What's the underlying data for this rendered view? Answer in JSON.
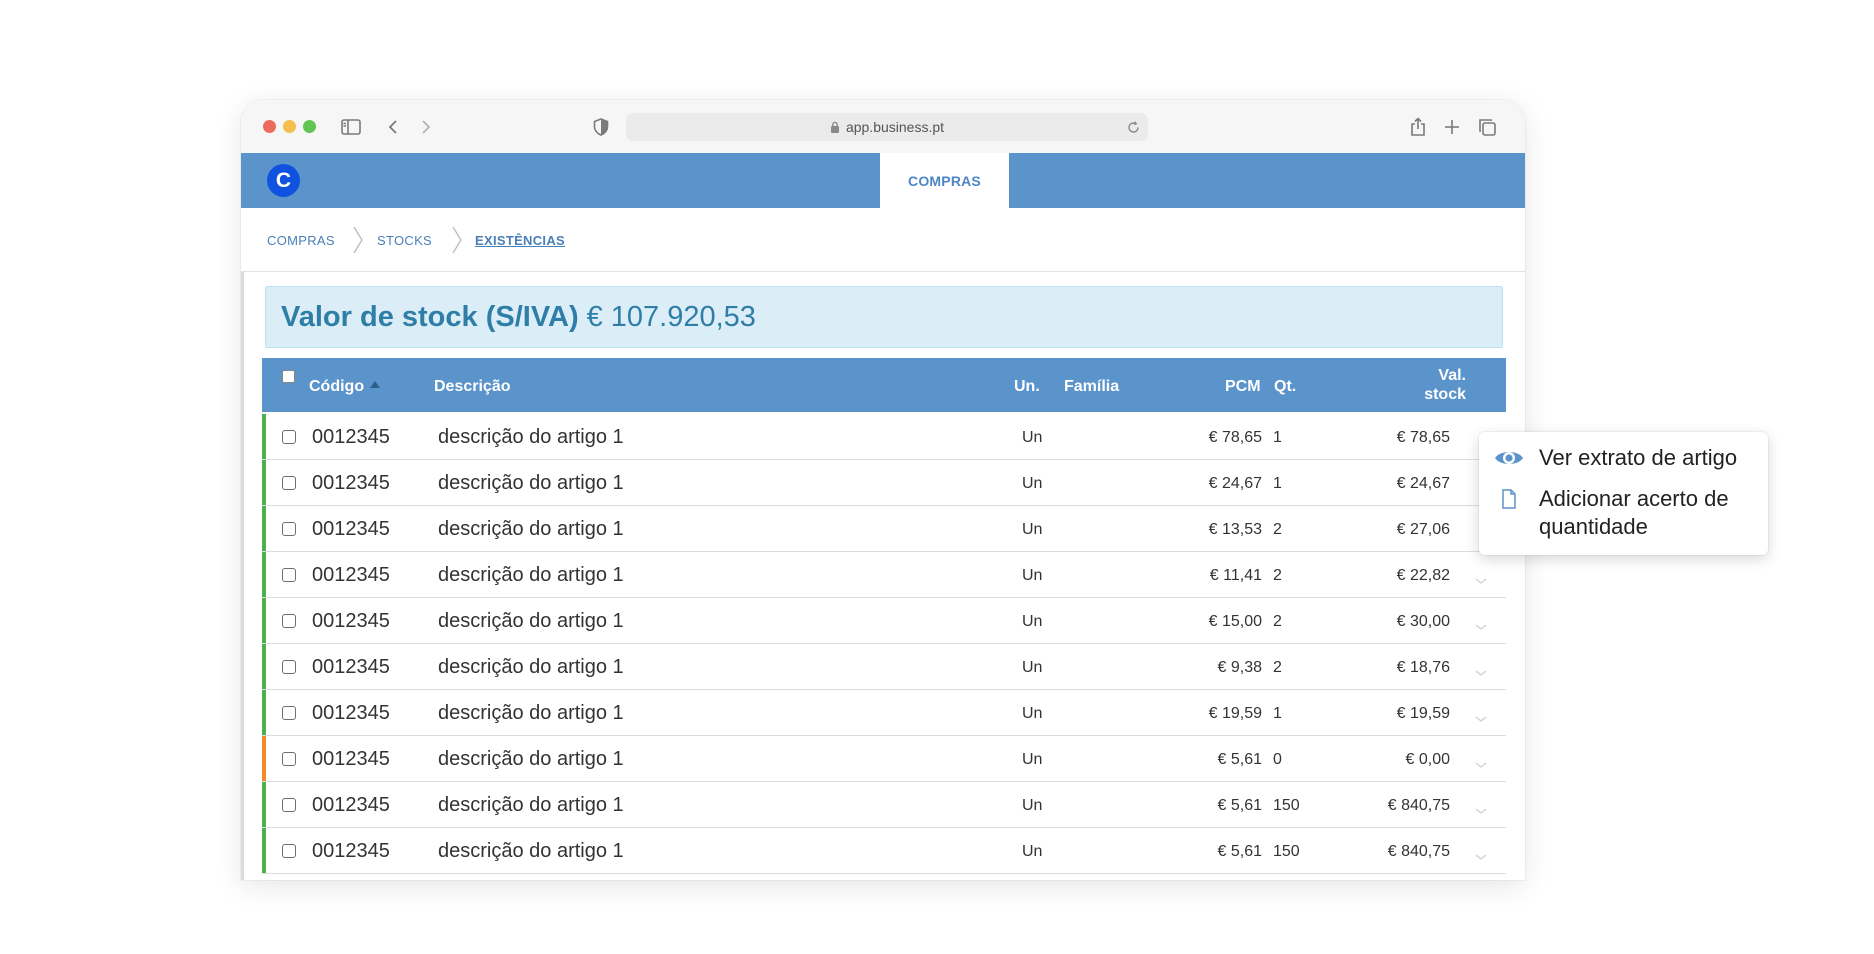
{
  "browser": {
    "url": "app.business.pt"
  },
  "app": {
    "logo_letter": "C",
    "active_tab": "COMPRAS"
  },
  "breadcrumb": {
    "items": [
      "COMPRAS",
      "STOCKS",
      "EXISTÊNCIAS"
    ]
  },
  "summary": {
    "label": "Valor de stock (S/IVA)",
    "value": "€ 107.920,53"
  },
  "table": {
    "headers": {
      "codigo": "Código",
      "descricao": "Descrição",
      "un": "Un.",
      "familia": "Família",
      "pcm": "PCM",
      "qt": "Qt.",
      "val_stock_1": "Val.",
      "val_stock_2": "stock"
    },
    "rows": [
      {
        "status_color": "#4caf50",
        "code": "0012345",
        "desc": "descrição do artigo 1",
        "un": "Un",
        "pcm": "€ 78,65",
        "qt": "1",
        "val": "€ 78,65"
      },
      {
        "status_color": "#4caf50",
        "code": "0012345",
        "desc": "descrição do artigo 1",
        "un": "Un",
        "pcm": "€ 24,67",
        "qt": "1",
        "val": "€ 24,67"
      },
      {
        "status_color": "#4caf50",
        "code": "0012345",
        "desc": "descrição do artigo 1",
        "un": "Un",
        "pcm": "€ 13,53",
        "qt": "2",
        "val": "€ 27,06"
      },
      {
        "status_color": "#4caf50",
        "code": "0012345",
        "desc": "descrição do artigo 1",
        "un": "Un",
        "pcm": "€ 11,41",
        "qt": "2",
        "val": "€ 22,82"
      },
      {
        "status_color": "#4caf50",
        "code": "0012345",
        "desc": "descrição do artigo 1",
        "un": "Un",
        "pcm": "€ 15,00",
        "qt": "2",
        "val": "€ 30,00"
      },
      {
        "status_color": "#4caf50",
        "code": "0012345",
        "desc": "descrição do artigo 1",
        "un": "Un",
        "pcm": "€ 9,38",
        "qt": "2",
        "val": "€ 18,76"
      },
      {
        "status_color": "#4caf50",
        "code": "0012345",
        "desc": "descrição do artigo 1",
        "un": "Un",
        "pcm": "€ 19,59",
        "qt": "1",
        "val": "€ 19,59"
      },
      {
        "status_color": "#f28a2a",
        "code": "0012345",
        "desc": "descrição do artigo 1",
        "un": "Un",
        "pcm": "€ 5,61",
        "qt": "0",
        "val": "€ 0,00"
      },
      {
        "status_color": "#4caf50",
        "code": "0012345",
        "desc": "descrição do artigo 1",
        "un": "Un",
        "pcm": "€ 5,61",
        "qt": "150",
        "val": "€ 840,75"
      },
      {
        "status_color": "#4caf50",
        "code": "0012345",
        "desc": "descrição do artigo 1",
        "un": "Un",
        "pcm": "€ 5,61",
        "qt": "150",
        "val": "€ 840,75"
      }
    ]
  },
  "context_menu": {
    "items": [
      {
        "icon": "eye-icon",
        "label": "Ver extrato de artigo"
      },
      {
        "icon": "document-icon",
        "label": "Adicionar acerto de quantidade"
      }
    ]
  },
  "colors": {
    "header_blue": "#5b93cb",
    "summary_bg": "#dbedf7",
    "summary_text": "#2f7ea8",
    "logo_blue": "#0f52e0"
  }
}
